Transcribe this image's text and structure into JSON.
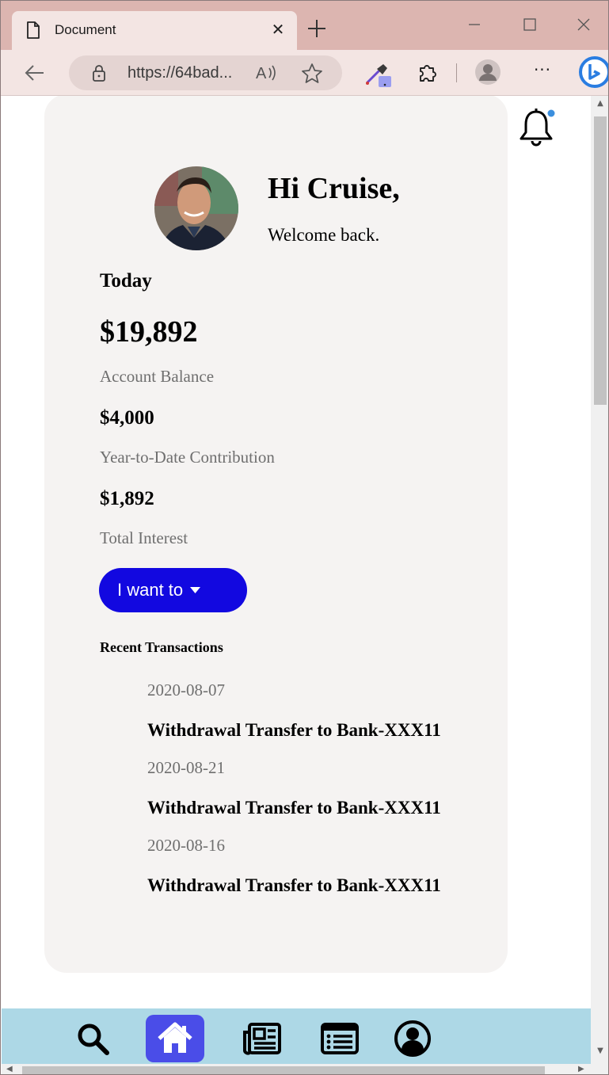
{
  "browser": {
    "tab_title": "Document",
    "tab_close": "✕",
    "url": "https://64bad...",
    "read_aloud": "Aᴵᴵ",
    "more": "···"
  },
  "header": {
    "greeting": "Hi Cruise,",
    "welcome": "Welcome back."
  },
  "summary": {
    "today_label": "Today",
    "balance": "$19,892",
    "balance_label": "Account Balance",
    "contribution": "$4,000",
    "contribution_label": "Year-to-Date Contribution",
    "interest": "$1,892",
    "interest_label": "Total Interest"
  },
  "actions": {
    "i_want_to": "I want to"
  },
  "transactions": {
    "title": "Recent Transactions",
    "items": [
      {
        "date": "2020-08-07",
        "description": "Withdrawal Transfer to Bank-XXX11"
      },
      {
        "date": "2020-08-21",
        "description": "Withdrawal Transfer to Bank-XXX11"
      },
      {
        "date": "2020-08-16",
        "description": "Withdrawal Transfer to Bank-XXX11"
      }
    ]
  },
  "bottom_nav": {
    "items": [
      "search-icon",
      "home-icon",
      "newspaper-icon",
      "list-icon",
      "user-icon"
    ]
  },
  "colors": {
    "title_bar": "#dcb5b0",
    "toolbar": "#f3e5e3",
    "card_bg": "#f5f3f2",
    "primary_button": "#1208e0",
    "bottom_nav": "#add8e6",
    "home_active": "#4a4de8",
    "notification_dot": "#3b8fde"
  }
}
